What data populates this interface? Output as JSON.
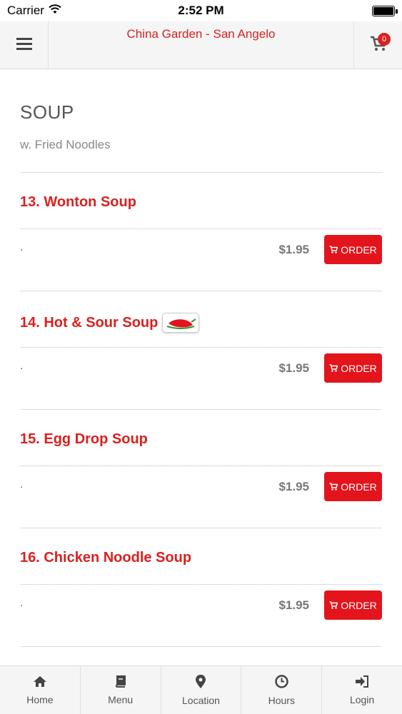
{
  "status_bar": {
    "carrier": "Carrier",
    "time": "2:52 PM"
  },
  "header": {
    "title": "China Garden - San Angelo",
    "cart_count": "0"
  },
  "section": {
    "title": "SOUP",
    "subtitle": "w. Fried Noodles"
  },
  "items": [
    {
      "name": "13. Wonton Soup",
      "desc": ".",
      "price": "$1.95",
      "order_label": "ORDER",
      "spicy": false
    },
    {
      "name": "14. Hot & Sour Soup",
      "desc": ".",
      "price": "$1.95",
      "order_label": "ORDER",
      "spicy": true
    },
    {
      "name": "15. Egg Drop Soup",
      "desc": ".",
      "price": "$1.95",
      "order_label": "ORDER",
      "spicy": false
    },
    {
      "name": "16. Chicken Noodle Soup",
      "desc": ".",
      "price": "$1.95",
      "order_label": "ORDER",
      "spicy": false
    }
  ],
  "tabs": [
    {
      "label": "Home",
      "icon": "home-icon"
    },
    {
      "label": "Menu",
      "icon": "book-icon"
    },
    {
      "label": "Location",
      "icon": "map-pin-icon"
    },
    {
      "label": "Hours",
      "icon": "clock-icon"
    },
    {
      "label": "Login",
      "icon": "login-icon"
    }
  ],
  "colors": {
    "accent": "#d9211f",
    "button": "#e3141b"
  }
}
